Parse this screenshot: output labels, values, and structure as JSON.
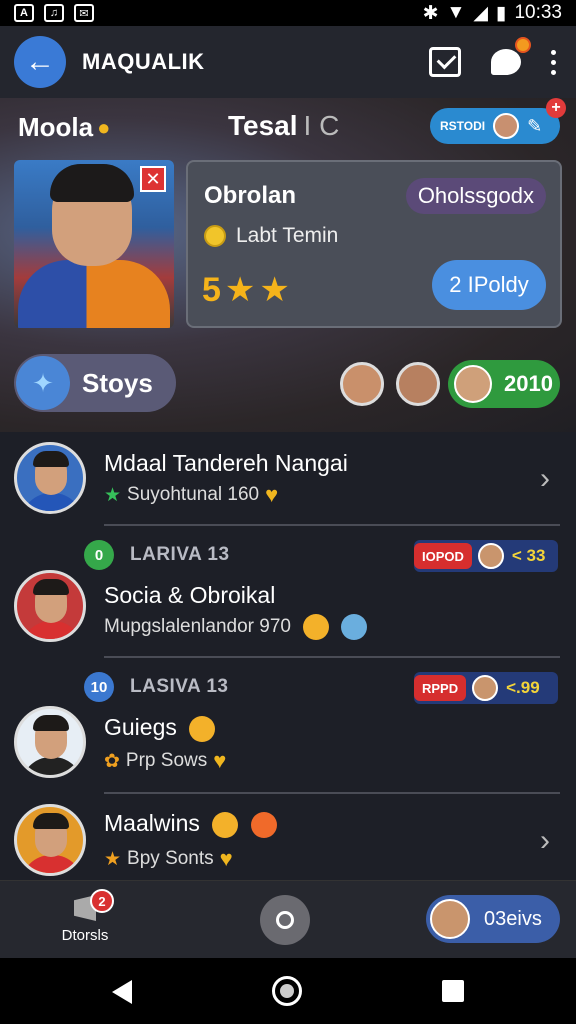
{
  "status_bar": {
    "time": "10:33"
  },
  "app_bar": {
    "title": "MAQUALIK"
  },
  "hero": {
    "left_label": "Moola",
    "center_title": "Tesal",
    "center_suffix": "I C",
    "pill_label": "RSTODI",
    "card": {
      "title": "Obrolan",
      "tag": "Oholssgodx",
      "subtitle": "Labt Temin",
      "stars_number": "5",
      "button_label": "2 IPoldy"
    },
    "stories_label": "Stoys",
    "stories_count": "2010"
  },
  "list": [
    {
      "title": "Mdaal Tandereh Nangai",
      "subtitle": "Suyohtunal 160"
    },
    {
      "rank": "0",
      "rank_label": "LARIVA 13",
      "score_tag": "IOPOD",
      "score": "< 33",
      "title": "Socia & Obroikal",
      "subtitle": "Mupgslalenlandor 970"
    },
    {
      "rank": "10",
      "rank_label": "LASIVA 13",
      "score_tag": "RPPD",
      "score": "<.99",
      "title": "Guiegs",
      "subtitle": "Prp Sows"
    },
    {
      "title": "Maalwins",
      "subtitle": "Bpy Sonts"
    }
  ],
  "bottom_nav": {
    "home_label": "Dtorsls",
    "home_badge": "2",
    "right_label": "03eivs"
  },
  "colors": {
    "accent": "#3a7ad6",
    "green": "#2f9a3e",
    "star": "#f5b31a"
  }
}
